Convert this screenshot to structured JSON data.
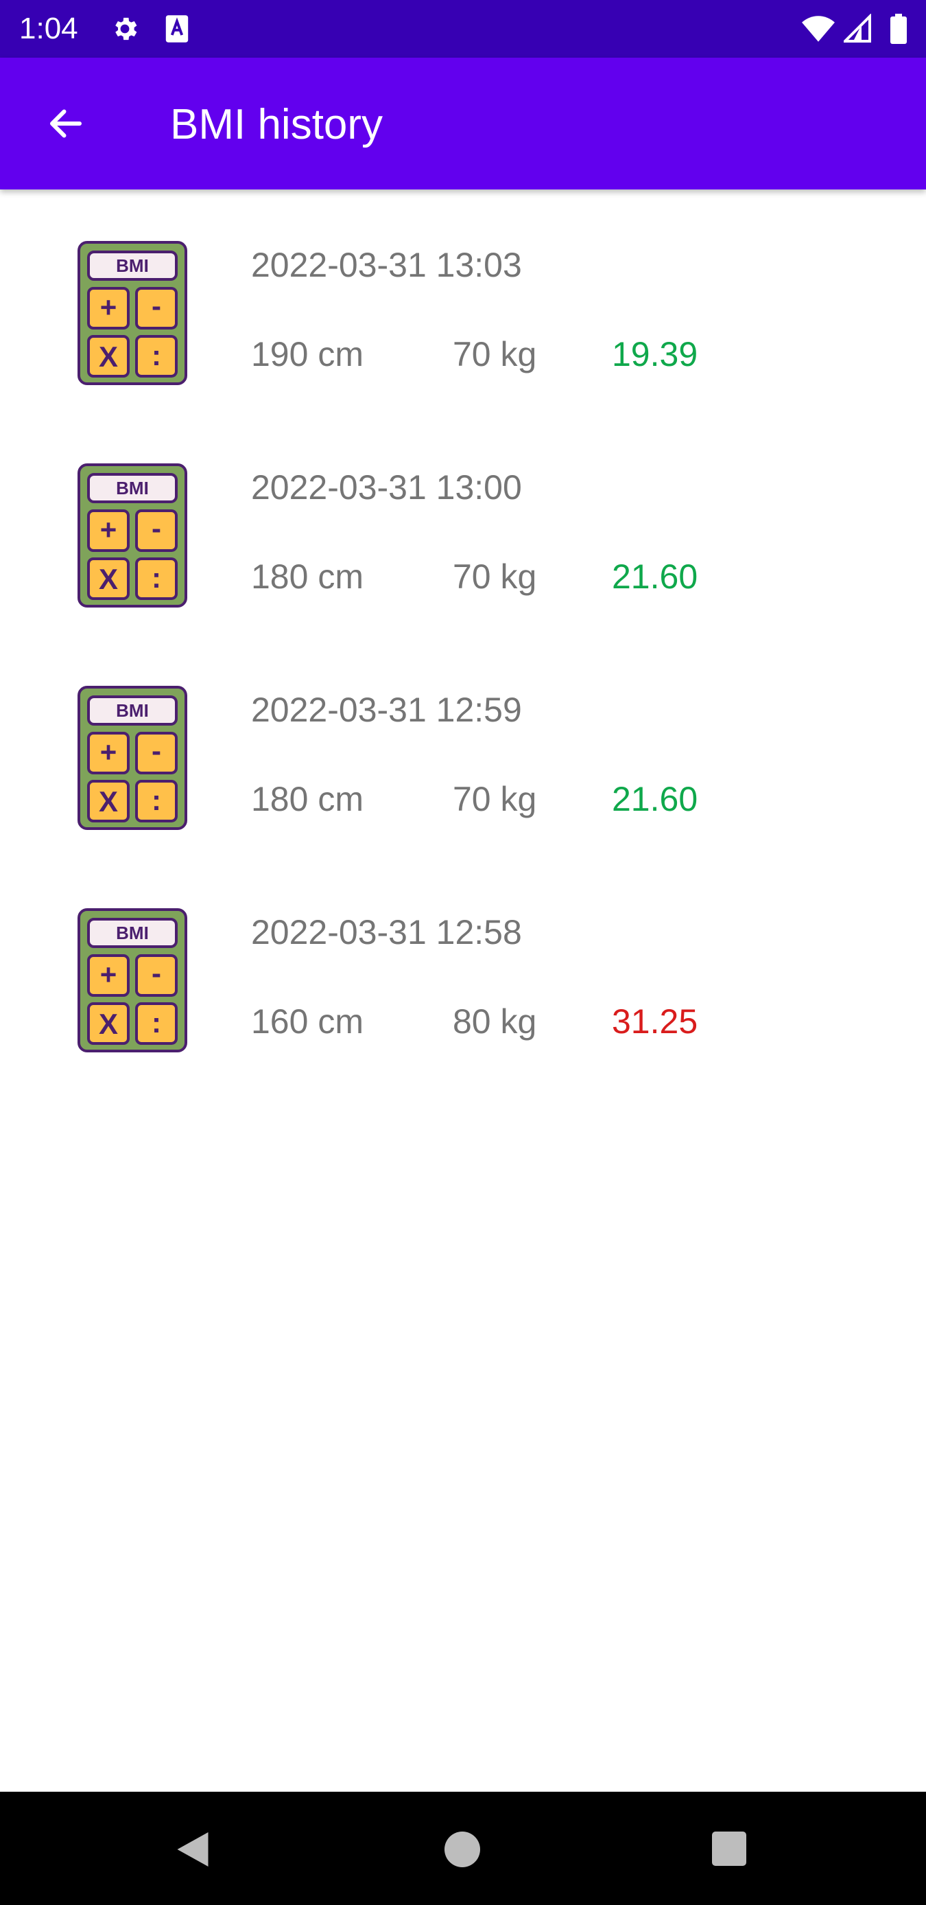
{
  "status_bar": {
    "time": "1:04",
    "icons": [
      "gear-icon",
      "a-icon",
      "wifi-icon",
      "signal-icon",
      "battery-icon"
    ],
    "background": "#3700b3"
  },
  "app_bar": {
    "title": "BMI history",
    "back_icon": "arrow-left-icon",
    "background": "#6200ee"
  },
  "history": [
    {
      "date": "2022-03-31 13:03",
      "height": "190 cm",
      "weight": "70 kg",
      "bmi": "19.39",
      "bmi_color": "#0fa84b"
    },
    {
      "date": "2022-03-31 13:00",
      "height": "180 cm",
      "weight": "70 kg",
      "bmi": "21.60",
      "bmi_color": "#0fa84b"
    },
    {
      "date": "2022-03-31 12:59",
      "height": "180 cm",
      "weight": "70 kg",
      "bmi": "21.60",
      "bmi_color": "#0fa84b"
    },
    {
      "date": "2022-03-31 12:58",
      "height": "160 cm",
      "weight": "80 kg",
      "bmi": "31.25",
      "bmi_color": "#d91c1c"
    }
  ],
  "calculator_icon": {
    "display_text": "BMI",
    "keys": [
      "+",
      "-",
      "X",
      ":"
    ]
  },
  "nav_bar": {
    "icons": [
      "nav-back-icon",
      "nav-home-icon",
      "nav-recents-icon"
    ]
  }
}
